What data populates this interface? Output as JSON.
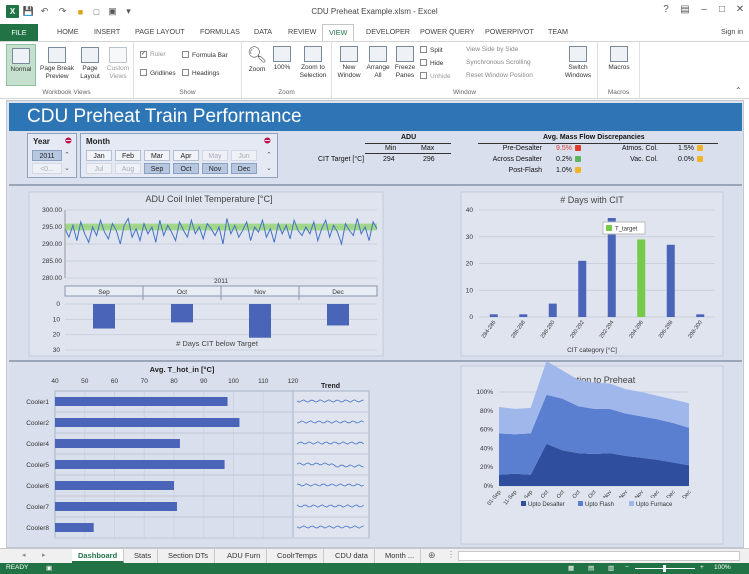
{
  "window": {
    "title": "CDU Preheat Example.xlsm - Excel",
    "help": "?",
    "user": "Sign in"
  },
  "ribbon_tabs": [
    "FILE",
    "HOME",
    "INSERT",
    "PAGE LAYOUT",
    "FORMULAS",
    "DATA",
    "REVIEW",
    "VIEW",
    "DEVELOPER",
    "POWER QUERY",
    "POWERPIVOT",
    "TEAM"
  ],
  "ribbon": {
    "workbook_views": {
      "label": "Workbook Views",
      "normal": "Normal",
      "page_break": "Page Break",
      "page_break2": "Preview",
      "page_layout": "Page",
      "page_layout2": "Layout",
      "custom": "Custom",
      "custom2": "Views"
    },
    "show": {
      "label": "Show",
      "ruler": "Ruler",
      "formula_bar": "Formula Bar",
      "gridlines": "Gridlines",
      "headings": "Headings"
    },
    "zoom": {
      "label": "Zoom",
      "zoom": "Zoom",
      "hundred": "100%",
      "zoom_sel": "Zoom to",
      "zoom_sel2": "Selection"
    },
    "window": {
      "label": "Window",
      "new": "New",
      "new2": "Window",
      "arrange": "Arrange",
      "arrange2": "All",
      "freeze": "Freeze",
      "freeze2": "Panes",
      "split": "Split",
      "hide": "Hide",
      "unhide": "Unhide",
      "side": "View Side by Side",
      "sync": "Synchronous Scrolling",
      "reset": "Reset Window Position",
      "switch": "Switch",
      "switch2": "Windows"
    },
    "macros": {
      "label": "Macros",
      "macros": "Macros"
    }
  },
  "dashboard": {
    "title": "CDU Preheat Train Performance",
    "year_slicer": {
      "header": "Year",
      "items": [
        {
          "label": "2011",
          "state": "sel"
        },
        {
          "label": "<0...",
          "state": "dim"
        }
      ]
    },
    "month_slicer": {
      "header": "Month",
      "row1": [
        {
          "label": "Jan",
          "state": "on"
        },
        {
          "label": "Feb",
          "state": "on"
        },
        {
          "label": "Mar",
          "state": "on"
        },
        {
          "label": "Apr",
          "state": "on"
        },
        {
          "label": "May",
          "state": "dim"
        },
        {
          "label": "Jun",
          "state": "dim"
        }
      ],
      "row2": [
        {
          "label": "Jul",
          "state": "dim"
        },
        {
          "label": "Aug",
          "state": "dim"
        },
        {
          "label": "Sep",
          "state": "sel"
        },
        {
          "label": "Oct",
          "state": "sel"
        },
        {
          "label": "Nov",
          "state": "sel"
        },
        {
          "label": "Dec",
          "state": "sel"
        }
      ]
    },
    "adu_table": {
      "header": "ADU",
      "min_label": "Min",
      "max_label": "Max",
      "row_label": "CIT Target [°C]",
      "min": "294",
      "max": "296"
    },
    "mass_flow": {
      "header": "Avg. Mass Flow Discrepancies",
      "rows": [
        {
          "label": "Pre-Desalter",
          "value": "9.5%",
          "color": "#e23b2e",
          "red": true
        },
        {
          "label": "Across Desalter",
          "value": "0.2%",
          "color": "#5ab65a"
        },
        {
          "label": "Post-Flash",
          "value": "1.0%",
          "color": "#f0b429"
        }
      ],
      "right_rows": [
        {
          "label": "Atmos. Col.",
          "value": "1.5%",
          "color": "#f0b429"
        },
        {
          "label": "Vac. Col.",
          "value": "0.0%",
          "color": "#f0b429"
        }
      ]
    }
  },
  "chart_data": [
    {
      "type": "line",
      "title": "ADU Coil Inlet Temperature [°C]",
      "y_ticks": [
        "300.00",
        "295.00",
        "290.00",
        "285.00",
        "280.00"
      ],
      "ylim": [
        280,
        300
      ],
      "target_band": [
        294,
        296
      ],
      "series": [
        {
          "values": [
            294.5,
            292,
            295.5,
            291,
            296.5,
            293,
            290.5,
            295,
            292.5,
            297,
            293.5,
            291.5,
            296,
            294,
            290,
            295.5,
            297.5,
            292,
            294.5,
            291,
            296,
            293,
            295,
            290.5,
            297,
            292.5,
            295.5,
            293.5,
            291,
            296.5,
            294,
            292,
            297,
            293,
            295,
            291.5,
            296,
            294.5,
            292.5,
            295,
            290,
            297.5,
            293,
            295.5,
            292,
            294,
            296.5,
            291,
            295,
            293.5,
            297,
            292,
            294.5,
            290.5,
            296,
            293,
            295.5,
            291.5,
            297,
            294,
            292.5,
            295,
            293,
            296.5,
            291,
            294.5,
            297,
            292,
            295.5,
            293.5,
            290,
            296,
            294,
            292.5,
            297.5,
            293,
            295,
            291,
            296.5,
            294.5
          ]
        }
      ]
    },
    {
      "type": "bar",
      "title": "# Days CIT below Target",
      "year_label": "2011",
      "categories": [
        "Sep",
        "Oct",
        "Nov",
        "Dec"
      ],
      "values": [
        16,
        12,
        22,
        14
      ],
      "ylim": [
        0,
        30
      ],
      "y_ticks": [
        "0",
        "10",
        "20",
        "30"
      ]
    },
    {
      "type": "bar",
      "title": "# Days with CIT",
      "xlabel": "CIT category [°C]",
      "categories": [
        "284-286",
        "286-288",
        "288-290",
        "290-292",
        "292-294",
        "294-296",
        "296-298",
        "298-300"
      ],
      "values": [
        1,
        1,
        5,
        21,
        37,
        29,
        27,
        1
      ],
      "highlight_index": 5,
      "legend": "T_target",
      "ylim": [
        0,
        40
      ],
      "y_ticks": [
        "40",
        "30",
        "20",
        "10",
        "0"
      ]
    },
    {
      "type": "bar",
      "title": "Avg. T_hot_in [°C]",
      "orientation": "horizontal",
      "categories": [
        "Cooler1",
        "Cooler2",
        "Cooler4",
        "Cooler5",
        "Cooler6",
        "Cooler7",
        "Cooler8"
      ],
      "values": [
        98,
        102,
        82,
        97,
        80,
        81,
        53
      ],
      "xlim": [
        40,
        120
      ],
      "x_ticks": [
        "40",
        "50",
        "60",
        "70",
        "80",
        "90",
        "100",
        "110",
        "120"
      ],
      "trend_label": "Trend"
    },
    {
      "type": "area",
      "title": "Contribution to Preheat",
      "x": [
        "01-Sep",
        "11-Sep",
        "21-Sep",
        "01-Oct",
        "11-Oct",
        "21-Oct",
        "31-Oct",
        "10-Nov",
        "20-Nov",
        "30-Nov",
        "10-Dec",
        "20-Dec",
        "30-Dec"
      ],
      "y_ticks": [
        "100%",
        "80%",
        "60%",
        "40%",
        "20%",
        "0%"
      ],
      "ylim": [
        0,
        100
      ],
      "series": [
        {
          "name": "Upto Desalter",
          "values": [
            12,
            13,
            12,
            45,
            38,
            35,
            34,
            35,
            32,
            30,
            28,
            25,
            22
          ],
          "color": "#2f4f9e"
        },
        {
          "name": "Upto Flash",
          "values": [
            44,
            42,
            44,
            52,
            55,
            50,
            48,
            47,
            45,
            44,
            43,
            42,
            40
          ],
          "color": "#5b7fd0"
        },
        {
          "name": "Upto Furnace",
          "values": [
            28,
            27,
            27,
            36,
            30,
            28,
            28,
            27,
            26,
            26,
            25,
            25,
            26
          ],
          "color": "#9fb7ea"
        }
      ]
    }
  ],
  "sheet_tabs": [
    "Dashboard",
    "Stats",
    "Section DTs",
    "ADU Furn",
    "CoolrTemps",
    "CDU data",
    "Month ..."
  ],
  "status": {
    "ready": "READY",
    "zoom": "100%"
  }
}
